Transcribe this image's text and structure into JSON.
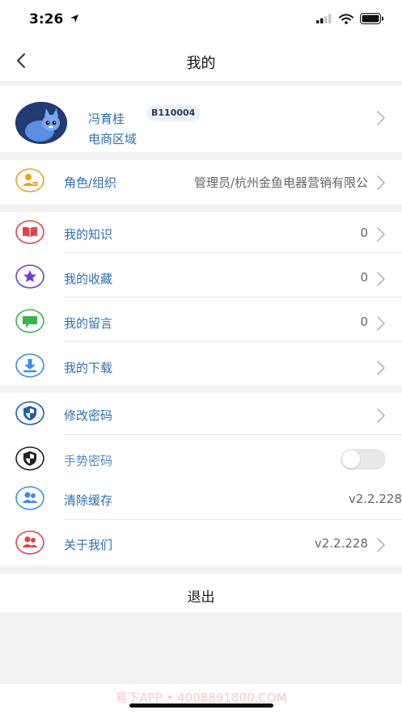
{
  "status_bar": {
    "time": "3:26"
  },
  "nav": {
    "title": "我的"
  },
  "profile": {
    "name": "冯育桂",
    "badge": "B110004",
    "region": "电商区域"
  },
  "role_row": {
    "label": "角色/组织",
    "value": "管理员/杭州金鱼电器营销有限公"
  },
  "group1": [
    {
      "label": "我的知识",
      "value": "0",
      "icon": "book-icon",
      "color": "#e2434b"
    },
    {
      "label": "我的收藏",
      "value": "0",
      "icon": "star-icon",
      "color": "#6b3fd6"
    },
    {
      "label": "我的留言",
      "value": "0",
      "icon": "message-icon",
      "color": "#39b54a"
    },
    {
      "label": "我的下载",
      "value": "",
      "icon": "download-icon",
      "color": "#3a8ee6"
    }
  ],
  "group2": {
    "change_password": {
      "label": "修改密码",
      "icon": "shield-icon",
      "color": "#1f5fa8"
    },
    "gesture_password": {
      "label": "手势密码",
      "icon": "shield-icon",
      "color": "#222222",
      "enabled": false
    },
    "clear_cache": {
      "label": "清除缓存",
      "value": "v2.2.228",
      "icon": "users-icon",
      "color": "#3a8ee6"
    },
    "about_us": {
      "label": "关于我们",
      "value": "v2.2.228",
      "icon": "users-icon",
      "color": "#e2434b"
    }
  },
  "logout": {
    "label": "退出"
  },
  "watermark": "易下APP • 4008891800.COM"
}
